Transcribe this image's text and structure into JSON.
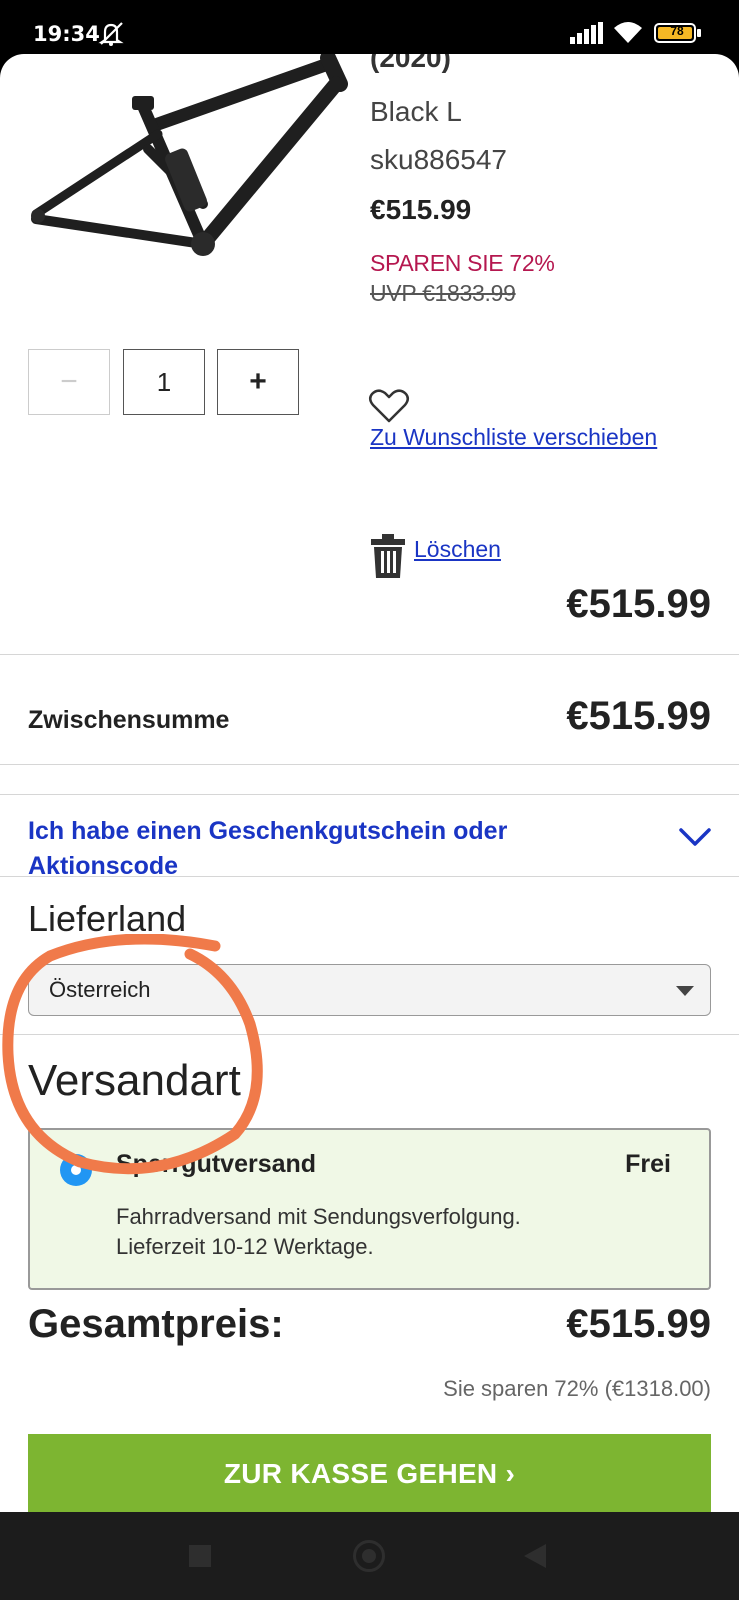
{
  "status_bar": {
    "time": "19:34",
    "battery": "78"
  },
  "product": {
    "title_fragment": "(2020)",
    "variant": "Black L",
    "sku": "sku886547",
    "price": "€515.99",
    "savings_badge": "SPAREN SIE 72%",
    "rrp": "UVP €1833.99",
    "quantity": "1",
    "qty_minus_label": "−",
    "qty_plus_label": "+",
    "wishlist_link": "Zu Wunschliste verschieben",
    "delete_link": "Löschen",
    "line_total": "€515.99"
  },
  "summary": {
    "subtotal_label": "Zwischensumme",
    "subtotal_value": "€515.99",
    "coupon_toggle": "Ich habe einen Geschenkgutschein oder Aktionscode",
    "country_heading": "Lieferland",
    "country_selected": "Österreich",
    "shipping_heading": "Versandart",
    "shipping_option": {
      "name": "Sperrgutversand",
      "price": "Frei",
      "description_line1": "Fahrradversand mit Sendungsverfolgung.",
      "description_line2": "Lieferzeit 10-12 Werktage.",
      "selected": true
    },
    "total_label": "Gesamtpreis:",
    "total_value": "€515.99",
    "savings_note": "Sie sparen 72% (€1318.00)",
    "checkout_button": "ZUR KASSE GEHEN ›"
  },
  "colors": {
    "link_blue": "#1a35c4",
    "savings_red": "#b5174f",
    "checkout_green": "#7db531",
    "shipping_bg": "#f0f8e6",
    "radio_blue": "#2196f3",
    "annotation_orange": "#f07a4a"
  },
  "icons": [
    "muted-bell-icon",
    "signal-icon",
    "wifi-icon",
    "battery-icon",
    "heart-icon",
    "trash-icon",
    "chevron-down-icon",
    "select-caret-icon",
    "radio-selected-icon",
    "nav-recents-icon",
    "nav-home-icon",
    "nav-back-icon"
  ]
}
